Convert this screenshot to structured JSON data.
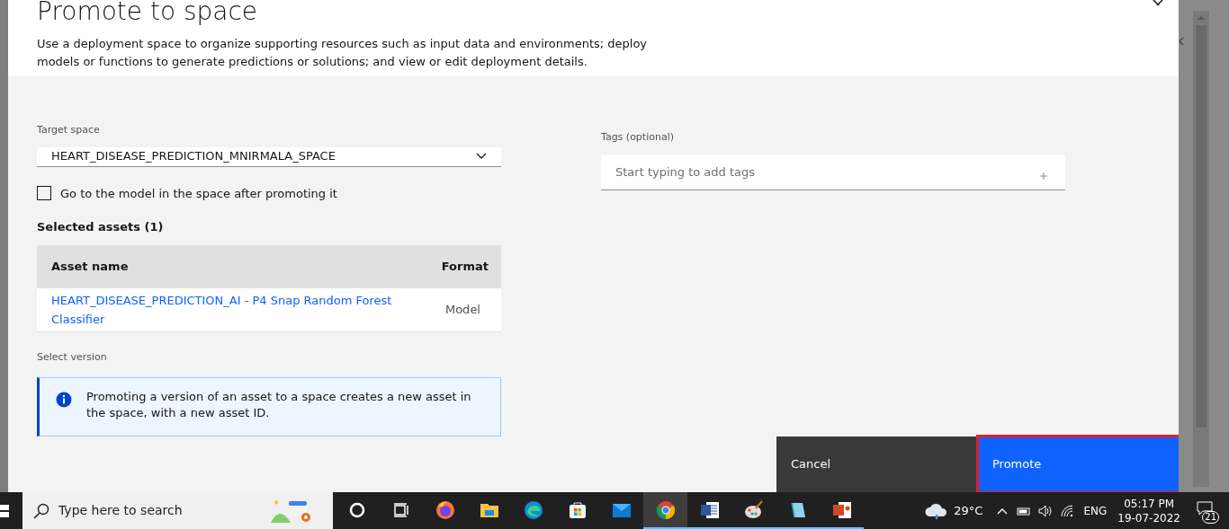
{
  "dialog": {
    "title": "Promote to space",
    "description": "Use a deployment space to organize supporting resources such as input data and environments; deploy models or functions to generate predictions or solutions; and view or edit deployment details."
  },
  "target_space": {
    "label": "Target space",
    "value": "HEART_DISEASE_PREDICTION_MNIRMALA_SPACE"
  },
  "checkbox": {
    "label": "Go to the model in the space after promoting it",
    "checked": false
  },
  "selected_assets": {
    "heading": "Selected assets (1)",
    "columns": [
      "Asset name",
      "Format"
    ],
    "rows": [
      {
        "asset_name": "HEART_DISEASE_PREDICTION_AI - P4 Snap Random Forest Classifier",
        "format": "Model"
      }
    ]
  },
  "select_version": {
    "label": "Select version"
  },
  "info": {
    "text": "Promoting a version of an asset to a space creates a new asset in the space, with a new asset ID."
  },
  "tags": {
    "label": "Tags (optional)",
    "placeholder": "Start typing to add tags"
  },
  "buttons": [
    {
      "label": "Cancel",
      "kind": "secondary",
      "highlighted": false
    },
    {
      "label": "Promote",
      "kind": "primary",
      "highlighted": true
    }
  ],
  "taskbar": {
    "search_placeholder": "Type here to search",
    "apps": [
      {
        "kind": "cortana",
        "selected": false,
        "running": false
      },
      {
        "kind": "taskview",
        "selected": false,
        "running": false
      },
      {
        "kind": "firefox",
        "selected": false,
        "running": false
      },
      {
        "kind": "files",
        "selected": false,
        "running": false
      },
      {
        "kind": "edge",
        "selected": false,
        "running": false
      },
      {
        "kind": "store",
        "selected": false,
        "running": false
      },
      {
        "kind": "mail",
        "selected": false,
        "running": false
      },
      {
        "kind": "chrome",
        "selected": true,
        "running": true
      },
      {
        "kind": "word",
        "selected": false,
        "running": true
      },
      {
        "kind": "paint",
        "selected": false,
        "running": true
      },
      {
        "kind": "notepad",
        "selected": false,
        "running": true
      },
      {
        "kind": "powerpoint",
        "selected": false,
        "running": true
      }
    ],
    "weather": "29°C",
    "language": "ENG",
    "time": "05:17 PM",
    "date": "19-07-2022",
    "notifications": "21"
  }
}
